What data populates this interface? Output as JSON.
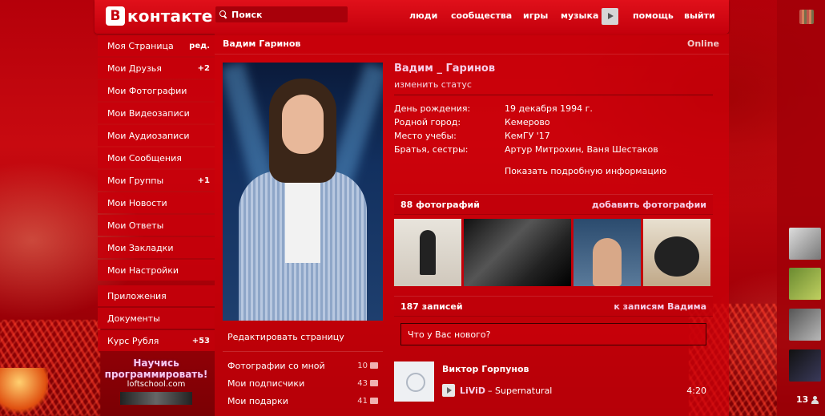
{
  "topbar": {
    "logo_text": "контакте",
    "logo_letter": "В",
    "search_label": "Поиск",
    "nav": [
      "люди",
      "сообщества",
      "игры",
      "музыка",
      "помощь",
      "выйти"
    ]
  },
  "menu": {
    "items": [
      {
        "label": "Моя Страница",
        "extra": "ред."
      },
      {
        "label": "Мои Друзья",
        "extra": "+2"
      },
      {
        "label": "Мои Фотографии",
        "extra": ""
      },
      {
        "label": "Мои Видеозаписи",
        "extra": ""
      },
      {
        "label": "Мои Аудиозаписи",
        "extra": ""
      },
      {
        "label": "Мои Сообщения",
        "extra": ""
      },
      {
        "label": "Мои Группы",
        "extra": "+1"
      },
      {
        "label": "Мои Новости",
        "extra": ""
      },
      {
        "label": "Мои Ответы",
        "extra": ""
      },
      {
        "label": "Мои Закладки",
        "extra": ""
      },
      {
        "label": "Мои Настройки",
        "extra": ""
      },
      {
        "label": "Приложения",
        "extra": ""
      },
      {
        "label": "Документы",
        "extra": ""
      },
      {
        "label": "Курс Рубля",
        "extra": "+53"
      }
    ],
    "promo_line1": "Научись программировать!",
    "promo_line2": "loftschool.com"
  },
  "profile": {
    "header_name": "Вадим Гаринов",
    "online": "Online",
    "full_name": "Вадим _ Гаринов",
    "change_status": "изменить статус",
    "fields": [
      {
        "label": "День рождения:",
        "value": "19 декабря 1994 г."
      },
      {
        "label": "Родной город:",
        "value": "Кемерово"
      },
      {
        "label": "Место учебы:",
        "value": "КемГУ '17"
      },
      {
        "label": "Братья, сестры:",
        "value": "Артур Митрохин, Ваня Шестаков"
      }
    ],
    "show_more": "Показать подробную информацию",
    "edit_page": "Редактировать страницу",
    "side_links": [
      {
        "label": "Фотографии со мной",
        "count": "10"
      },
      {
        "label": "Мои подписчики",
        "count": "43"
      },
      {
        "label": "Мои подарки",
        "count": "41"
      }
    ]
  },
  "photos": {
    "title": "88 фотографий",
    "action": "добавить фотографии"
  },
  "wall": {
    "title": "187 записей",
    "action": "к записям Вадима",
    "placeholder": "Что у Вас нового?",
    "post": {
      "author": "Виктор Горпунов",
      "track_artist": "LiViD",
      "track_title": "– Supernatural",
      "track_duration": "4:20"
    }
  },
  "right": {
    "online_count": "13"
  }
}
